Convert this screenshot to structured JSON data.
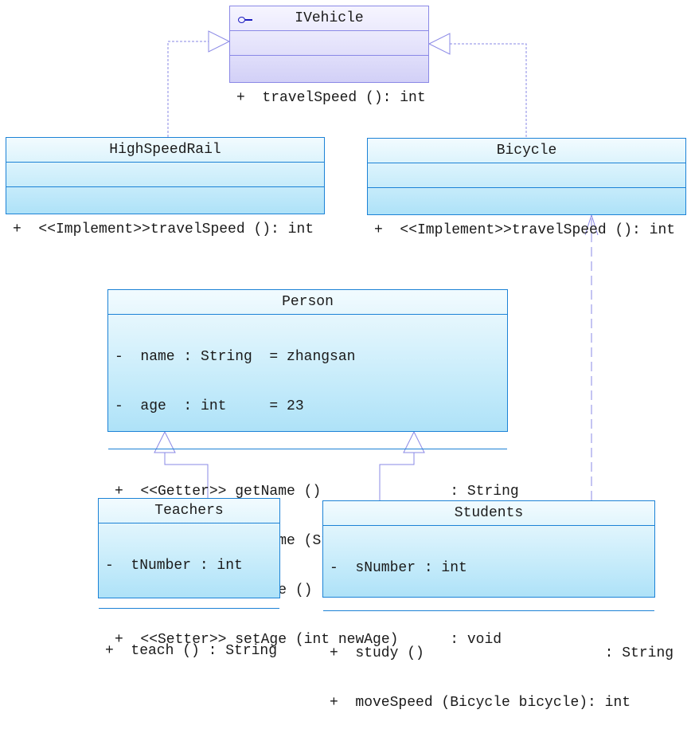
{
  "diagram_type": "UML class diagram",
  "colors": {
    "class_border": "#1c82d6",
    "interface_border": "#8a88e6",
    "edge": "#8a88e6",
    "interface_icon": "#1b1bc0"
  },
  "classes": {
    "ivehicle": {
      "name": "IVehicle",
      "stereotype_icon": "interface-icon",
      "attributes": [],
      "operations": [
        "+  travelSpeed (): int"
      ]
    },
    "highspeedrail": {
      "name": "HighSpeedRail",
      "attributes": [],
      "operations": [
        "+  <<Implement>>travelSpeed (): int"
      ]
    },
    "bicycle": {
      "name": "Bicycle",
      "attributes": [],
      "operations": [
        "+  <<Implement>>travelSpeed (): int"
      ]
    },
    "person": {
      "name": "Person",
      "attributes": [
        "-  name : String  = zhangsan",
        "-  age  : int     = 23"
      ],
      "operations": [
        "+  <<Getter>> getName ()               : String",
        "+  <<Setter>> setName (String newName): void",
        "+  <<Getter>> getAge ()                : int",
        "+  <<Setter>> setAge (int newAge)      : void"
      ]
    },
    "teachers": {
      "name": "Teachers",
      "attributes": [
        "-  tNumber : int"
      ],
      "operations": [
        "+  teach () : String"
      ]
    },
    "students": {
      "name": "Students",
      "attributes": [
        "-  sNumber : int"
      ],
      "operations": [
        "+  study ()                     : String",
        "+  moveSpeed (Bicycle bicycle): int"
      ]
    }
  },
  "relations": [
    {
      "type": "realization",
      "from": "HighSpeedRail",
      "to": "IVehicle"
    },
    {
      "type": "realization",
      "from": "Bicycle",
      "to": "IVehicle"
    },
    {
      "type": "generalization",
      "from": "Teachers",
      "to": "Person"
    },
    {
      "type": "generalization",
      "from": "Students",
      "to": "Person"
    },
    {
      "type": "dependency",
      "from": "Students",
      "to": "Bicycle"
    }
  ]
}
